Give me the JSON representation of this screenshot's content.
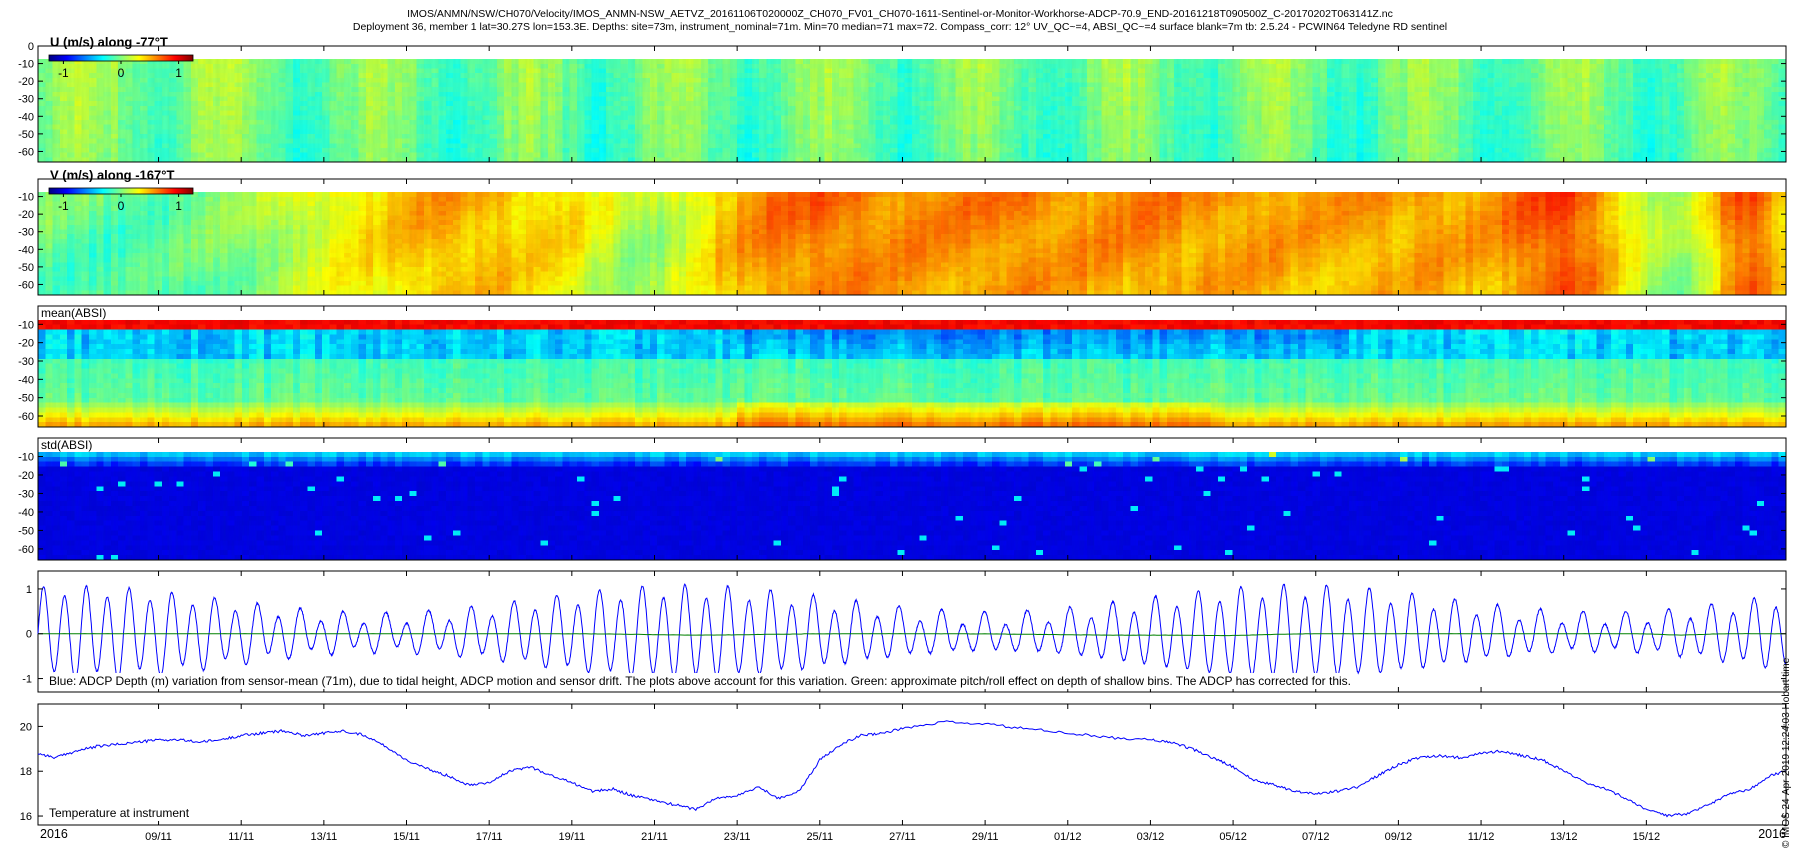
{
  "title_line1": "IMOS/ANMN/NSW/CH070/Velocity/IMOS_ANMN-NSW_AETVZ_20161106T020000Z_CH070_FV01_CH070-1611-Sentinel-or-Monitor-Workhorse-ADCP-70.9_END-20161218T090500Z_C-20170202T063141Z.nc",
  "title_line2": "Deployment 36, member 1 lat=30.27S lon=153.3E. Depths: site=73m, instrument_nominal=71m. Min=70 median=71 max=72. Compass_corr: 12° UV_QC~=4, ABSI_QC~=4 surface blank=7m tb: 2.5.24 - PCWIN64 Teledyne RD sentinel",
  "footer": "© IMOS 24-Apr-2019 12:24:03 Hobart time",
  "colors": {
    "line_blue": "#0000ff",
    "line_green": "#008000",
    "frame": "#000000"
  },
  "chart_data": [
    {
      "type": "heatmap",
      "label": "U (m/s) along -77°T",
      "colorbar": {
        "ticks": [
          "-1",
          "0",
          "1"
        ],
        "range": [
          -1.25,
          1.25
        ],
        "colormap": "jet"
      },
      "y_ticks": [
        "0",
        "-10",
        "-20",
        "-30",
        "-40",
        "-50",
        "-60"
      ],
      "ylim": [
        -66,
        0
      ],
      "x_tick_labels": [
        "2016",
        "09/11",
        "11/11",
        "13/11",
        "15/11",
        "17/11",
        "19/11",
        "21/11",
        "23/11",
        "25/11",
        "27/11",
        "29/11",
        "01/12",
        "03/12",
        "05/12",
        "07/12",
        "09/12",
        "11/12",
        "13/12",
        "15/12",
        "2016"
      ],
      "description_values": {
        "typical_value": 0.0,
        "range": [
          -0.6,
          0.4
        ]
      }
    },
    {
      "type": "heatmap",
      "label": "V (m/s) along -167°T",
      "colorbar": {
        "ticks": [
          "-1",
          "0",
          "1"
        ],
        "range": [
          -1.25,
          1.25
        ],
        "colormap": "jet"
      },
      "y_ticks": [
        "-10",
        "-20",
        "-30",
        "-40",
        "-50",
        "-60"
      ],
      "ylim": [
        -66,
        0
      ],
      "description_values": {
        "typical_value": 0.4,
        "range": [
          -0.3,
          1.1
        ]
      }
    },
    {
      "type": "heatmap",
      "label": "mean(ABSI)",
      "y_ticks": [
        "-10",
        "-20",
        "-30",
        "-40",
        "-50",
        "-60"
      ],
      "ylim": [
        -66,
        0
      ]
    },
    {
      "type": "heatmap",
      "label": "std(ABSI)",
      "y_ticks": [
        "-10",
        "-20",
        "-30",
        "-40",
        "-50",
        "-60"
      ],
      "ylim": [
        -66,
        0
      ]
    },
    {
      "type": "line",
      "y_ticks": [
        "1",
        "0",
        "-1"
      ],
      "ylim": [
        -1.3,
        1.4
      ],
      "caption": "Blue: ADCP Depth (m) variation from sensor-mean (71m), due to tidal height, ADCP motion and sensor drift. The plots above account for this variation. Green: approximate pitch/roll effect on depth of shallow bins. The ADCP has corrected for this.",
      "series": [
        {
          "color": "#0000ff",
          "kind": "tidal",
          "amplitude_range": [
            0.35,
            1.0
          ],
          "period_days": 0.5175
        },
        {
          "color": "#008000",
          "kind": "near_zero"
        }
      ]
    },
    {
      "type": "line",
      "y_ticks": [
        "20",
        "18",
        "16"
      ],
      "ylim": [
        15.6,
        21.0
      ],
      "caption": "Temperature at instrument",
      "x_tick_labels": [
        "2016",
        "09/11",
        "11/11",
        "13/11",
        "15/11",
        "17/11",
        "19/11",
        "21/11",
        "23/11",
        "25/11",
        "27/11",
        "29/11",
        "01/12",
        "03/12",
        "05/12",
        "07/12",
        "09/12",
        "11/12",
        "13/12",
        "15/12",
        "2016"
      ],
      "series": [
        {
          "color": "#0000ff",
          "x": [
            "2016-11-06 02:00",
            "2016-11-06 12:00",
            "2016-11-07 00:00",
            "2016-11-07 12:00",
            "2016-11-08 00:00",
            "2016-11-08 12:00",
            "2016-11-09 00:00",
            "2016-11-09 12:00",
            "2016-11-10 00:00",
            "2016-11-10 12:00",
            "2016-11-11 00:00",
            "2016-11-11 12:00",
            "2016-11-12 00:00",
            "2016-11-12 12:00",
            "2016-11-13 00:00",
            "2016-11-13 12:00",
            "2016-11-14 00:00",
            "2016-11-14 12:00",
            "2016-11-15 00:00",
            "2016-11-15 12:00",
            "2016-11-16 00:00",
            "2016-11-16 12:00",
            "2016-11-17 00:00",
            "2016-11-17 12:00",
            "2016-11-18 00:00",
            "2016-11-18 12:00",
            "2016-11-19 00:00",
            "2016-11-19 12:00",
            "2016-11-20 00:00",
            "2016-11-20 12:00",
            "2016-11-21 00:00",
            "2016-11-21 12:00",
            "2016-11-22 00:00",
            "2016-11-22 12:00",
            "2016-11-23 00:00",
            "2016-11-23 12:00",
            "2016-11-24 00:00",
            "2016-11-24 12:00",
            "2016-11-25 00:00",
            "2016-11-25 12:00",
            "2016-11-26 00:00",
            "2016-11-26 12:00",
            "2016-11-27 00:00",
            "2016-11-28 00:00",
            "2016-11-29 00:00",
            "2016-11-30 00:00",
            "2016-12-01 00:00",
            "2016-12-02 00:00",
            "2016-12-03 00:00",
            "2016-12-03 12:00",
            "2016-12-04 00:00",
            "2016-12-04 12:00",
            "2016-12-05 00:00",
            "2016-12-05 12:00",
            "2016-12-06 00:00",
            "2016-12-06 12:00",
            "2016-12-07 00:00",
            "2016-12-07 12:00",
            "2016-12-08 00:00",
            "2016-12-08 12:00",
            "2016-12-09 00:00",
            "2016-12-09 12:00",
            "2016-12-10 00:00",
            "2016-12-10 12:00",
            "2016-12-11 00:00",
            "2016-12-11 12:00",
            "2016-12-12 00:00",
            "2016-12-12 12:00",
            "2016-12-13 00:00",
            "2016-12-13 12:00",
            "2016-12-14 00:00",
            "2016-12-14 12:00",
            "2016-12-15 00:00",
            "2016-12-15 12:00",
            "2016-12-16 00:00",
            "2016-12-16 12:00",
            "2016-12-17 00:00",
            "2016-12-17 12:00",
            "2016-12-18 00:00",
            "2016-12-18 09:05"
          ],
          "y": [
            18.8,
            18.6,
            18.9,
            19.1,
            19.2,
            19.3,
            19.4,
            19.4,
            19.3,
            19.4,
            19.6,
            19.7,
            19.8,
            19.6,
            19.7,
            19.8,
            19.6,
            19.1,
            18.5,
            18.1,
            17.8,
            17.4,
            17.5,
            18.0,
            18.2,
            17.8,
            17.5,
            17.1,
            17.2,
            16.9,
            16.7,
            16.5,
            16.3,
            16.8,
            16.9,
            17.3,
            16.8,
            17.1,
            18.5,
            19.2,
            19.6,
            19.7,
            19.9,
            20.2,
            20.1,
            19.9,
            19.7,
            19.5,
            19.4,
            19.3,
            19.0,
            18.6,
            18.2,
            17.6,
            17.4,
            17.1,
            17.0,
            17.1,
            17.3,
            17.8,
            18.3,
            18.6,
            18.7,
            18.6,
            18.8,
            18.9,
            18.7,
            18.5,
            18.0,
            17.5,
            17.2,
            16.8,
            16.3,
            16.0,
            16.1,
            16.5,
            17.0,
            17.2,
            17.8,
            18.0
          ]
        }
      ]
    }
  ]
}
